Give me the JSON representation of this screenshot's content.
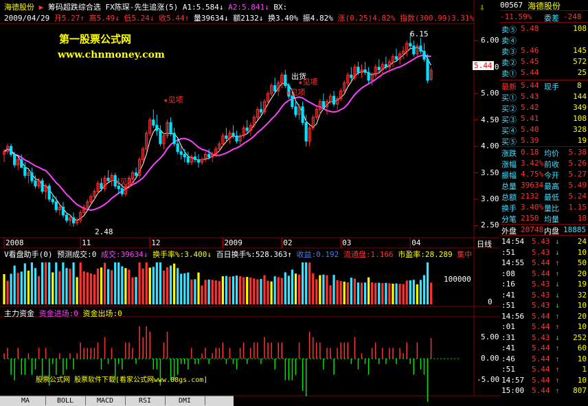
{
  "header": {
    "stock_name": "海德股份",
    "indicator_name": "筹码超跌综合选",
    "formula": "FX陈琛-先生追涨(5)",
    "a1": "A1:5.584",
    "a2": "A2:5.841",
    "bx": "BX:",
    "date": "2009/04/29",
    "open": "开5.27",
    "high": "高5.49",
    "low": "低5.24",
    "close": "收5.44",
    "volume": "量39634",
    "amount": "额2132",
    "turnover": "换3.40%",
    "amplitude": "振4.82%",
    "change": "涨(0.25)4.82%",
    "index": "指数(300.99)3.31%"
  },
  "watermark": {
    "line1": "第一股票公式网",
    "line2": "www.chnmoney.com"
  },
  "price_chart": {
    "annotations": [
      {
        "text": "见项",
        "at_day": 44
      },
      {
        "text": "见项",
        "at_day": 31
      },
      {
        "text": "出货",
        "at_day": 80
      },
      {
        "text": "见项",
        "at_day": 84
      },
      {
        "text": "见项",
        "at_day": 81
      }
    ],
    "high_label": "6.15",
    "low_label": "2.48",
    "y_ticks": [
      "6.00",
      "5.50",
      "5.00",
      "4.50",
      "4.00",
      "3.50",
      "3.00",
      "2.50"
    ],
    "y_range": [
      2.35,
      6.25
    ],
    "current_price_tag": "5.44",
    "x_labels": [
      "2008",
      "11",
      "12",
      "2009",
      "02",
      "03",
      "04"
    ],
    "x_label_days": [
      0,
      22,
      42,
      63,
      80,
      97,
      117
    ],
    "period_label": "日线"
  },
  "volume_panel": {
    "title": "V看盘助手(0)",
    "forecast": "预测成交:0",
    "volume": "成交:39634",
    "turnover": "换手率%:3.400",
    "hundred_day": "百日换手%:528.363",
    "profit": "收益:0.192",
    "float": "流通盘:1.166",
    "pe": "市盈率:28.289",
    "extra": "集中",
    "y_ticks": [
      "100000",
      "0"
    ],
    "y_range": [
      0,
      160000
    ]
  },
  "fund_panel": {
    "title": "主力资金",
    "inflow": "资金进场:0",
    "outflow": "资金出场:0",
    "y_ticks": [
      "5.00",
      "0.00",
      "-5.00"
    ],
    "y_range": [
      -7,
      8
    ],
    "watermark": "股票公式网 股票软件下载[看家公式网www.88gs.com]"
  },
  "chart_data": {
    "type": "candlestick",
    "x_range_days": [
      0,
      131
    ],
    "candles": [
      [
        3.85,
        3.95,
        3.7,
        3.9
      ],
      [
        3.9,
        4.05,
        3.85,
        4.0
      ],
      [
        4.0,
        4.05,
        3.8,
        3.85
      ],
      [
        3.85,
        3.9,
        3.6,
        3.65
      ],
      [
        3.65,
        3.8,
        3.55,
        3.75
      ],
      [
        3.75,
        3.85,
        3.6,
        3.6
      ],
      [
        3.6,
        3.7,
        3.4,
        3.45
      ],
      [
        3.45,
        3.55,
        3.3,
        3.5
      ],
      [
        3.5,
        3.6,
        3.3,
        3.35
      ],
      [
        3.35,
        3.45,
        3.2,
        3.25
      ],
      [
        3.25,
        3.4,
        3.2,
        3.35
      ],
      [
        3.35,
        3.4,
        3.1,
        3.15
      ],
      [
        3.15,
        3.3,
        3.0,
        3.25
      ],
      [
        3.25,
        3.3,
        2.95,
        3.0
      ],
      [
        3.0,
        3.1,
        2.9,
        2.95
      ],
      [
        2.95,
        3.05,
        2.75,
        2.8
      ],
      [
        2.8,
        2.9,
        2.7,
        2.85
      ],
      [
        2.85,
        2.95,
        2.65,
        2.7
      ],
      [
        2.7,
        2.75,
        2.55,
        2.6
      ],
      [
        2.6,
        2.7,
        2.5,
        2.65
      ],
      [
        2.65,
        2.75,
        2.48,
        2.55
      ],
      [
        2.55,
        2.65,
        2.5,
        2.6
      ],
      [
        2.6,
        2.8,
        2.55,
        2.75
      ],
      [
        2.75,
        2.9,
        2.7,
        2.85
      ],
      [
        2.85,
        3.0,
        2.8,
        2.95
      ],
      [
        2.95,
        3.1,
        2.9,
        3.05
      ],
      [
        3.05,
        3.2,
        3.0,
        3.15
      ],
      [
        3.15,
        3.35,
        3.1,
        3.3
      ],
      [
        3.3,
        3.4,
        3.15,
        3.2
      ],
      [
        3.2,
        3.45,
        3.15,
        3.4
      ],
      [
        3.4,
        3.55,
        3.3,
        3.35
      ],
      [
        3.35,
        3.5,
        3.25,
        3.45
      ],
      [
        3.45,
        3.5,
        3.2,
        3.25
      ],
      [
        3.25,
        3.4,
        3.1,
        3.2
      ],
      [
        3.2,
        3.3,
        3.05,
        3.1
      ],
      [
        3.1,
        3.3,
        3.05,
        3.25
      ],
      [
        3.25,
        3.45,
        3.2,
        3.4
      ],
      [
        3.4,
        3.55,
        3.35,
        3.5
      ],
      [
        3.5,
        3.6,
        3.4,
        3.45
      ],
      [
        3.45,
        3.8,
        3.4,
        3.75
      ],
      [
        3.75,
        4.0,
        3.7,
        3.95
      ],
      [
        3.95,
        4.3,
        3.9,
        4.25
      ],
      [
        4.25,
        4.55,
        4.2,
        4.5
      ],
      [
        4.5,
        4.7,
        4.35,
        4.4
      ],
      [
        4.4,
        4.6,
        4.2,
        4.3
      ],
      [
        4.3,
        4.4,
        4.0,
        4.05
      ],
      [
        4.05,
        4.25,
        3.95,
        4.2
      ],
      [
        4.2,
        4.5,
        4.15,
        4.45
      ],
      [
        4.45,
        4.55,
        4.2,
        4.25
      ],
      [
        4.25,
        4.35,
        4.0,
        4.05
      ],
      [
        4.05,
        4.15,
        3.85,
        3.9
      ],
      [
        3.9,
        4.0,
        3.75,
        3.85
      ],
      [
        3.85,
        3.95,
        3.7,
        3.8
      ],
      [
        3.8,
        3.9,
        3.65,
        3.7
      ],
      [
        3.7,
        3.85,
        3.65,
        3.8
      ],
      [
        3.8,
        3.9,
        3.7,
        3.75
      ],
      [
        3.75,
        3.85,
        3.6,
        3.7
      ],
      [
        3.7,
        3.8,
        3.65,
        3.75
      ],
      [
        3.75,
        3.9,
        3.7,
        3.85
      ],
      [
        3.85,
        3.95,
        3.75,
        3.8
      ],
      [
        3.8,
        3.9,
        3.7,
        3.85
      ],
      [
        3.85,
        4.0,
        3.8,
        3.95
      ],
      [
        3.95,
        4.1,
        3.9,
        4.05
      ],
      [
        4.05,
        4.25,
        4.0,
        4.2
      ],
      [
        4.2,
        4.35,
        4.1,
        4.15
      ],
      [
        4.15,
        4.3,
        4.05,
        4.25
      ],
      [
        4.25,
        4.4,
        4.15,
        4.2
      ],
      [
        4.2,
        4.3,
        4.05,
        4.1
      ],
      [
        4.1,
        4.25,
        4.0,
        4.2
      ],
      [
        4.2,
        4.4,
        4.15,
        4.35
      ],
      [
        4.35,
        4.5,
        4.25,
        4.3
      ],
      [
        4.3,
        4.45,
        4.2,
        4.4
      ],
      [
        4.4,
        4.6,
        4.35,
        4.55
      ],
      [
        4.55,
        4.75,
        4.5,
        4.7
      ],
      [
        4.7,
        4.85,
        4.6,
        4.65
      ],
      [
        4.65,
        4.9,
        4.6,
        4.85
      ],
      [
        4.85,
        5.05,
        4.8,
        5.0
      ],
      [
        5.0,
        5.2,
        4.95,
        5.15
      ],
      [
        5.15,
        5.3,
        5.0,
        5.05
      ],
      [
        5.05,
        5.25,
        4.95,
        5.2
      ],
      [
        5.2,
        5.4,
        5.1,
        5.35
      ],
      [
        5.35,
        5.45,
        5.1,
        5.15
      ],
      [
        5.15,
        5.2,
        4.9,
        4.95
      ],
      [
        4.95,
        5.05,
        4.7,
        4.75
      ],
      [
        4.75,
        4.85,
        4.55,
        4.6
      ],
      [
        4.6,
        4.8,
        4.5,
        4.75
      ],
      [
        4.75,
        4.85,
        4.4,
        4.45
      ],
      [
        4.45,
        4.6,
        4.0,
        4.1
      ],
      [
        4.1,
        4.4,
        4.0,
        4.35
      ],
      [
        4.35,
        4.6,
        4.3,
        4.55
      ],
      [
        4.55,
        4.75,
        4.5,
        4.7
      ],
      [
        4.7,
        4.9,
        4.6,
        4.85
      ],
      [
        4.85,
        5.0,
        4.7,
        4.75
      ],
      [
        4.75,
        4.9,
        4.6,
        4.85
      ],
      [
        4.85,
        5.0,
        4.8,
        4.95
      ],
      [
        4.95,
        5.05,
        4.75,
        4.8
      ],
      [
        4.8,
        4.95,
        4.7,
        4.9
      ],
      [
        4.9,
        5.1,
        4.85,
        5.05
      ],
      [
        5.05,
        5.25,
        5.0,
        5.2
      ],
      [
        5.2,
        5.4,
        5.15,
        5.35
      ],
      [
        5.35,
        5.5,
        5.2,
        5.3
      ],
      [
        5.3,
        5.55,
        5.25,
        5.5
      ],
      [
        5.5,
        5.6,
        5.35,
        5.4
      ],
      [
        5.4,
        5.55,
        5.3,
        5.45
      ],
      [
        5.45,
        5.6,
        5.35,
        5.4
      ],
      [
        5.4,
        5.5,
        5.2,
        5.25
      ],
      [
        5.25,
        5.4,
        5.15,
        5.35
      ],
      [
        5.35,
        5.55,
        5.3,
        5.5
      ],
      [
        5.5,
        5.65,
        5.4,
        5.45
      ],
      [
        5.45,
        5.6,
        5.35,
        5.55
      ],
      [
        5.55,
        5.7,
        5.45,
        5.5
      ],
      [
        5.5,
        5.65,
        5.4,
        5.6
      ],
      [
        5.6,
        5.75,
        5.5,
        5.7
      ],
      [
        5.7,
        5.85,
        5.6,
        5.65
      ],
      [
        5.65,
        5.8,
        5.55,
        5.75
      ],
      [
        5.75,
        5.9,
        5.65,
        5.8
      ],
      [
        5.8,
        6.0,
        5.7,
        5.95
      ],
      [
        5.95,
        6.15,
        5.85,
        5.9
      ],
      [
        5.9,
        6.0,
        5.7,
        5.75
      ],
      [
        5.75,
        5.95,
        5.7,
        5.9
      ],
      [
        5.9,
        6.05,
        5.75,
        5.8
      ],
      [
        5.8,
        5.95,
        5.6,
        5.65
      ],
      [
        5.65,
        5.75,
        5.2,
        5.25
      ],
      [
        5.27,
        5.49,
        5.24,
        5.44
      ]
    ],
    "ma_line_note": "trend line"
  },
  "right_panel": {
    "code": "00567",
    "name": "海德股份",
    "wei_bi": "委比",
    "wei_bi_val": "-11.59%",
    "wei_cha": "委差",
    "wei_cha_val": "-248",
    "sell": [
      {
        "label": "卖⑤",
        "price": "5.48",
        "vol": "108"
      },
      {
        "label": "卖④",
        "price": "",
        "vol": ""
      },
      {
        "label": "卖③",
        "price": "5.46",
        "vol": "145"
      },
      {
        "label": "卖②",
        "price": "5.45",
        "vol": "572"
      },
      {
        "label": "卖①",
        "price": "5.44",
        "vol": "25"
      }
    ],
    "latest_label": "最新",
    "latest": "5.44",
    "current_hand_label": "现手",
    "current_hand": "8",
    "buy": [
      {
        "label": "买①",
        "price": "5.43",
        "vol": "144"
      },
      {
        "label": "买②",
        "price": "5.42",
        "vol": "349"
      },
      {
        "label": "买③",
        "price": "5.41",
        "vol": "108"
      },
      {
        "label": "买④",
        "price": "5.40",
        "vol": "328"
      },
      {
        "label": "买⑤",
        "price": "5.39",
        "vol": "19"
      }
    ],
    "stats": [
      {
        "l1": "涨跌",
        "v1": "0.18",
        "l2": "均价",
        "v2": "5.38"
      },
      {
        "l1": "涨幅",
        "v1": "3.42%",
        "l2": "前收",
        "v2": "5.26"
      },
      {
        "l1": "振幅",
        "v1": "4.75%",
        "l2": "今开",
        "v2": "5.27"
      },
      {
        "l1": "总量",
        "v1": "39634",
        "l2": "最高",
        "v2": "5.49"
      },
      {
        "l1": "总额",
        "v1": "2132",
        "l2": "最低",
        "v2": "5.24"
      },
      {
        "l1": "换手",
        "v1": "3.40%",
        "l2": "量比",
        "v2": "1.15"
      },
      {
        "l1": "分笔",
        "v1": "2150",
        "l2": "均量",
        "v2": "18"
      }
    ],
    "outer_label": "外盘",
    "outer": "20748",
    "inner_label": "内盘",
    "inner": "18885",
    "ticks": [
      {
        "t": "14:54",
        "p": "5.43",
        "d": "↓",
        "v": "24"
      },
      {
        "t": ":51",
        "p": "5.43",
        "d": "↓",
        "v": "10"
      },
      {
        "t": "14:55",
        "p": "5.44",
        "d": "↑",
        "v": "50"
      },
      {
        "t": ":08",
        "p": "5.44",
        "d": "↑",
        "v": "20"
      },
      {
        "t": ":16",
        "p": "5.43",
        "d": "↓",
        "v": "19"
      },
      {
        "t": ":41",
        "p": "5.43",
        "d": "↓",
        "v": "32"
      },
      {
        "t": ":51",
        "p": "5.43",
        "d": "↓",
        "v": "10"
      },
      {
        "t": "14:56",
        "p": "5.44",
        "d": "↑",
        "v": "20"
      },
      {
        "t": ":01",
        "p": "5.44",
        "d": "↑",
        "v": "10"
      },
      {
        "t": ":31",
        "p": "5.43",
        "d": "↓",
        "v": "252"
      },
      {
        "t": ":41",
        "p": "5.44",
        "d": "↑",
        "v": "60"
      },
      {
        "t": ":46",
        "p": "5.44",
        "d": "↑",
        "v": "10"
      },
      {
        "t": ":51",
        "p": "5.44",
        "d": "↑",
        "v": "1"
      },
      {
        "t": "14:57",
        "p": "5.44",
        "d": "↑",
        "v": "10"
      },
      {
        "t": "15:00",
        "p": "5.44",
        "d": "↑",
        "v": "807"
      }
    ]
  },
  "tabs": [
    "MA",
    "BOLL",
    "MACD",
    "RSI",
    "DMI"
  ],
  "colors": {
    "up": "#ff3232",
    "down": "#00e0ff",
    "ma": "#ff40ff",
    "grid": "#800000"
  }
}
